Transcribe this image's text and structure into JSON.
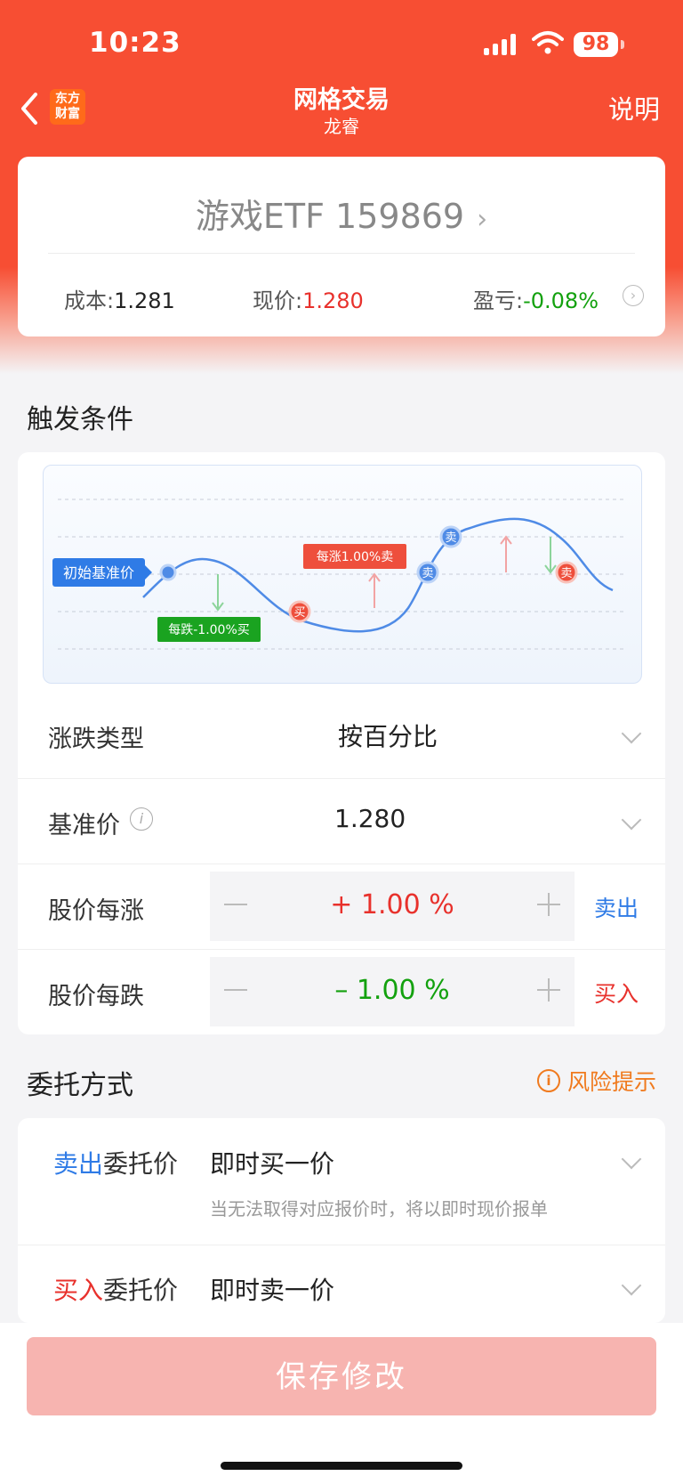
{
  "status_bar": {
    "time": "10:23",
    "battery": "98"
  },
  "nav": {
    "logo_line1": "东方",
    "logo_line2": "财富",
    "title": "网格交易",
    "subtitle": "龙睿",
    "help": "说明"
  },
  "stock": {
    "name": "游戏ETF 159869",
    "cost_label": "成本:",
    "cost_value": "1.281",
    "price_label": "现价:",
    "price_value": "1.280",
    "pnl_label": "盈亏:",
    "pnl_value": "-0.08%"
  },
  "trigger": {
    "title": "触发条件",
    "diagram": {
      "base_label": "初始基准价",
      "fall_label": "每跌-1.00%买",
      "rise_label": "每涨1.00%卖",
      "buy_marker": "买",
      "sell_marker": "卖"
    },
    "rows": {
      "type_label": "涨跌类型",
      "type_value": "按百分比",
      "base_label": "基准价",
      "base_value": "1.280",
      "rise_label": "股价每涨",
      "rise_value": "+ 1.00 %",
      "rise_action": "卖出",
      "fall_label": "股价每跌",
      "fall_value": "– 1.00 %",
      "fall_action": "买入"
    }
  },
  "order": {
    "title": "委托方式",
    "risk": "风险提示",
    "sell_kind_colored": "卖出",
    "sell_kind_rest": "委托价",
    "sell_value": "即时买一价",
    "sell_note": "当无法取得对应报价时，将以即时现价报单",
    "buy_kind_colored": "买入",
    "buy_kind_rest": "委托价",
    "buy_value": "即时卖一价"
  },
  "footer": {
    "save": "保存修改"
  },
  "colors": {
    "brand": "#f74e33",
    "up": "#e8312c",
    "down": "#13a10e",
    "blue": "#2f7be6",
    "orange": "#f07a1e"
  }
}
